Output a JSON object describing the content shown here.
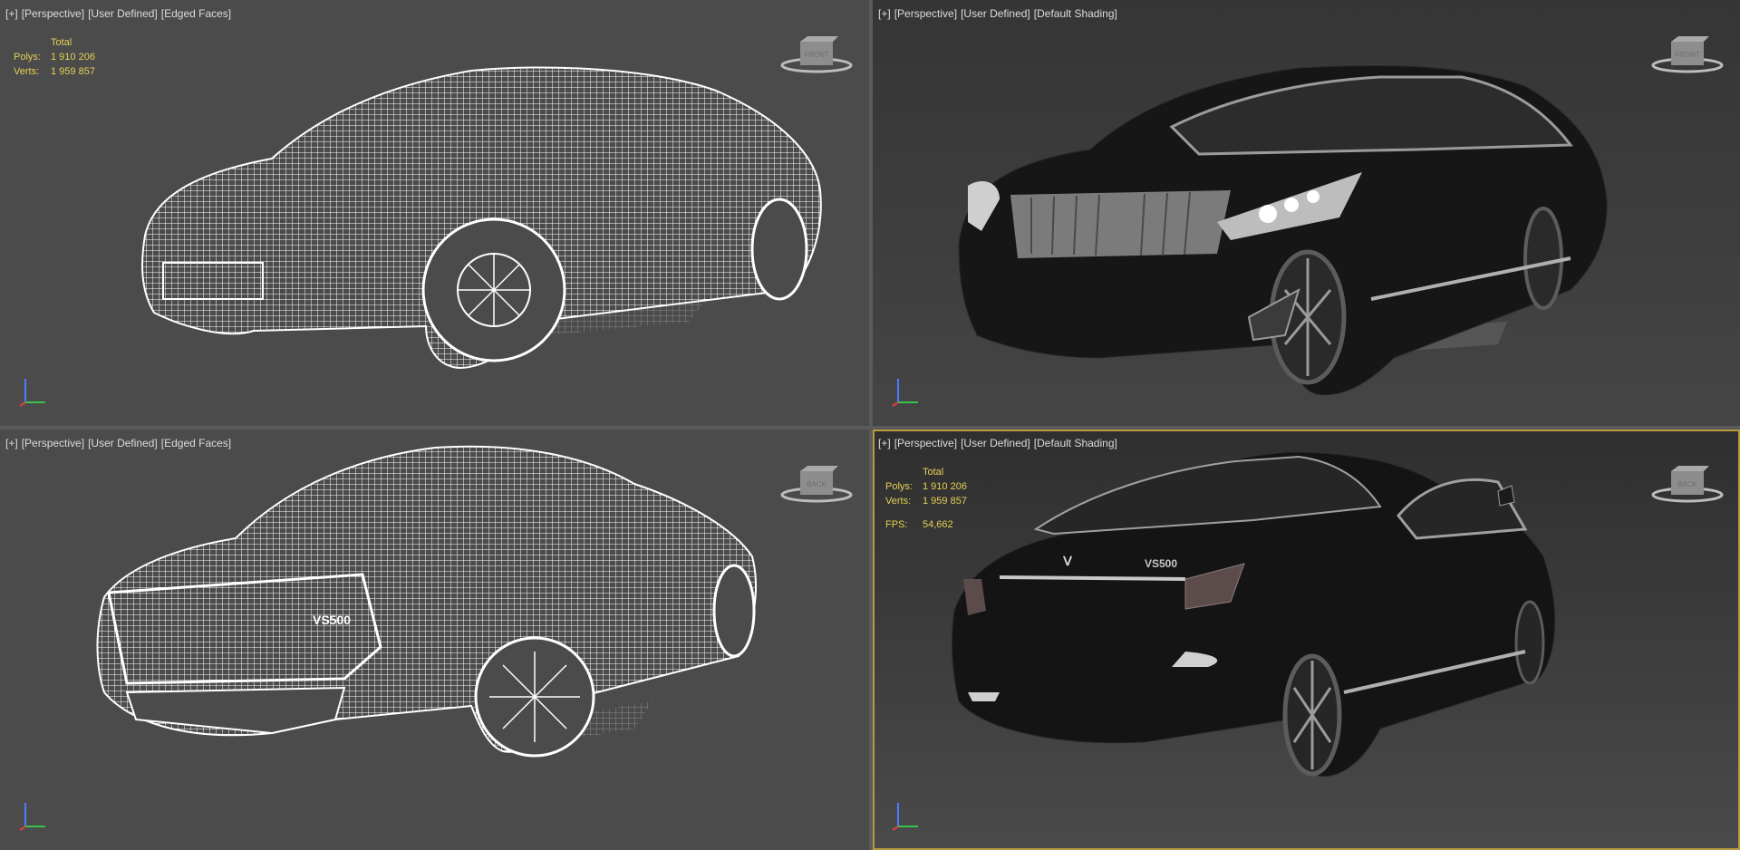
{
  "viewports": {
    "top_left": {
      "label_parts": [
        "[+]",
        "[Perspective]",
        "[User Defined]",
        "[Edged Faces]"
      ],
      "stats": {
        "total_label": "Total",
        "polys_label": "Polys:",
        "polys_value": "1 910 206",
        "verts_label": "Verts:",
        "verts_value": "1 959 857"
      }
    },
    "top_right": {
      "label_parts": [
        "[+]",
        "[Perspective]",
        "[User Defined]",
        "[Default Shading]"
      ]
    },
    "bottom_left": {
      "label_parts": [
        "[+]",
        "[Perspective]",
        "[User Defined]",
        "[Edged Faces]"
      ]
    },
    "bottom_right": {
      "label_parts": [
        "[+]",
        "[Perspective]",
        "[User Defined]",
        "[Default Shading]"
      ],
      "stats": {
        "total_label": "Total",
        "polys_label": "Polys:",
        "polys_value": "1 910 206",
        "verts_label": "Verts:",
        "verts_value": "1 959 857",
        "fps_label": "FPS:",
        "fps_value": "54,662"
      },
      "active": true
    }
  },
  "viewcube_face_front": "FRONT",
  "viewcube_face_back": "BACK",
  "car_badge": "VS500",
  "colors": {
    "stats": "#e4d054",
    "active_border": "#b89b3c",
    "wire": "#ffffff",
    "body_paint": "#161616"
  }
}
